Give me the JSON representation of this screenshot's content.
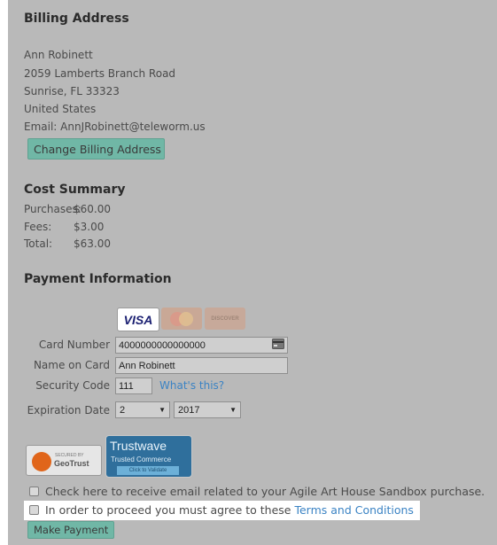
{
  "billing": {
    "title": "Billing Address",
    "name": "Ann Robinett",
    "street": "2059 Lamberts Branch Road",
    "city": "Sunrise, FL 33323",
    "country": "United States",
    "email": "Email: AnnJRobinett@teleworm.us",
    "change_button": "Change Billing Address"
  },
  "cost": {
    "title": "Cost Summary",
    "rows": [
      {
        "label": "Purchases:",
        "value": "$60.00"
      },
      {
        "label": "Fees:",
        "value": "$3.00"
      },
      {
        "label": "Total:",
        "value": "$63.00"
      }
    ]
  },
  "payment": {
    "title": "Payment Information",
    "cards": [
      "VISA",
      "MasterCard",
      "DISCOVER"
    ],
    "card_number_label": "Card Number",
    "card_number_value": "4000000000000000",
    "name_label": "Name on Card",
    "name_value": "Ann Robinett",
    "security_label": "Security Code",
    "security_value": "111",
    "whats_this": "What's this?",
    "expiration_label": "Expiration Date",
    "exp_month": "2",
    "exp_year": "2017"
  },
  "badges": {
    "geotrust_top": "SECURED BY",
    "geotrust_name": "GeoTrust",
    "trustwave_name": "Trustwave",
    "trustwave_sub": "Trusted Commerce",
    "trustwave_click": "Click to Validate"
  },
  "checks": {
    "email_optin": "Check here to receive email related to your Agile Art House Sandbox purchase.",
    "terms_prefix": "In order to proceed you must agree to these ",
    "terms_link": "Terms and Conditions"
  },
  "submit_label": "Make Payment",
  "colors": {
    "overlay": "#b9b9b9",
    "button": "#70b7a6",
    "link": "#3b83c4",
    "visa": "#1a1f71"
  }
}
